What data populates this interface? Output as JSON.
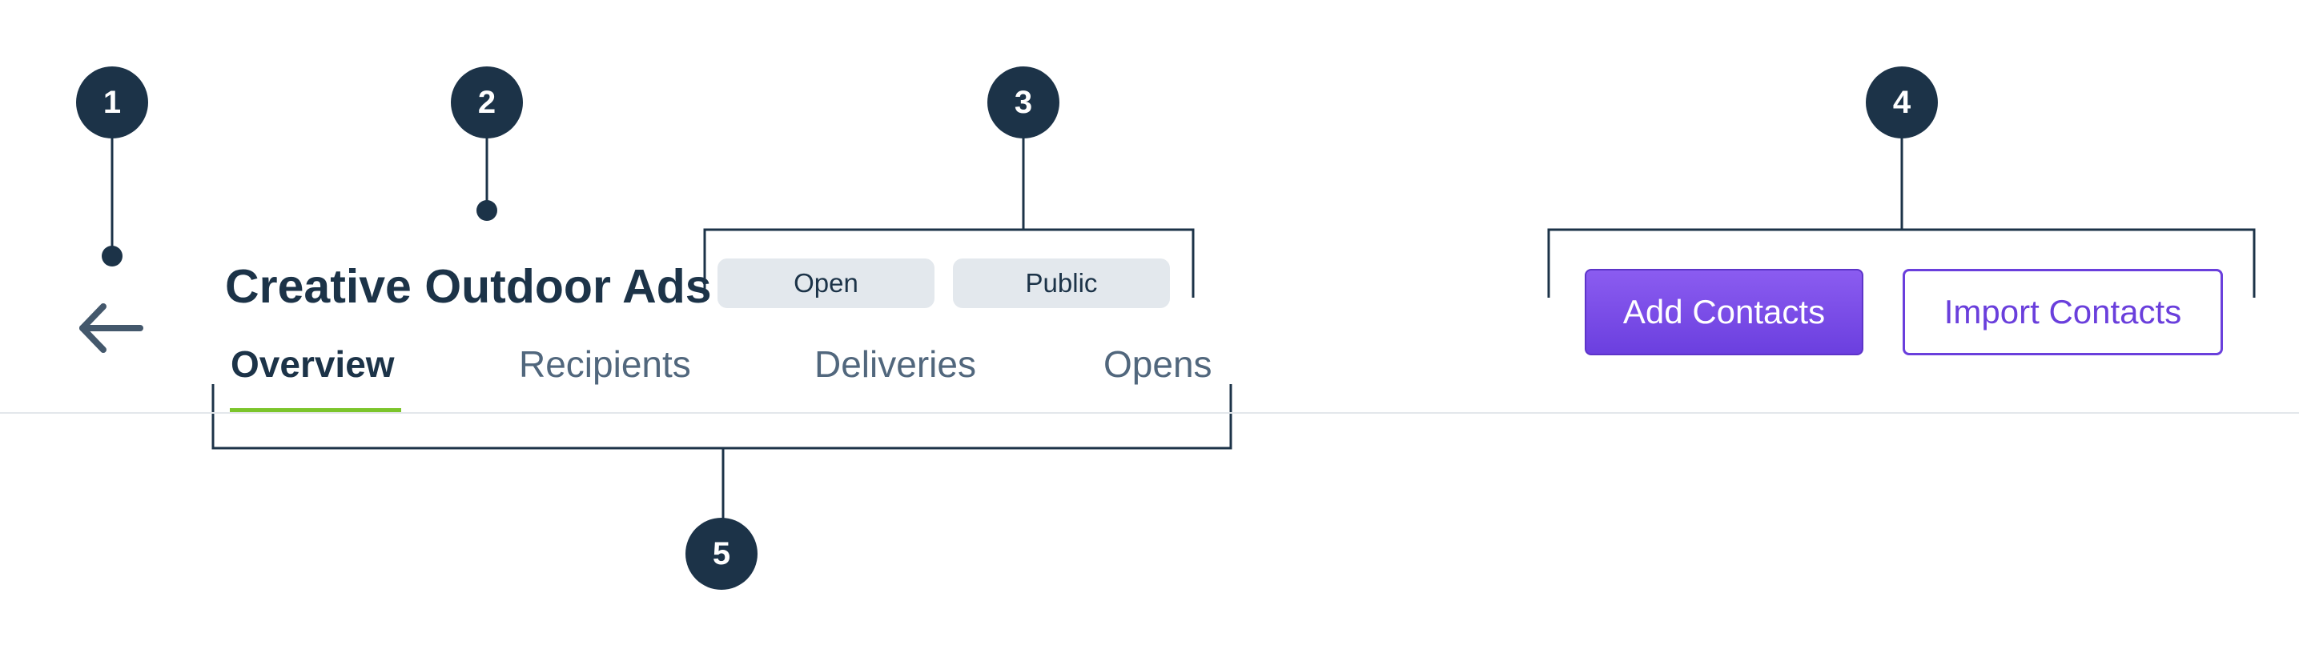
{
  "markers": [
    "1",
    "2",
    "3",
    "4",
    "5"
  ],
  "header": {
    "title": "Creative Outdoor Ads",
    "badges": [
      "Open",
      "Public"
    ]
  },
  "tabs": [
    {
      "label": "Overview",
      "active": true
    },
    {
      "label": "Recipients",
      "active": false
    },
    {
      "label": "Deliveries",
      "active": false
    },
    {
      "label": "Opens",
      "active": false
    }
  ],
  "actions": {
    "primary_label": "Add Contacts",
    "secondary_label": "Import Contacts"
  },
  "icons": {
    "back": "arrow-left-icon"
  },
  "colors": {
    "marker": "#1c3348",
    "title": "#1c3348",
    "tab_inactive": "#51677d",
    "tab_indicator": "#7cc52b",
    "primary": "#7c4ee8",
    "badge_bg": "#e3e8ed"
  }
}
